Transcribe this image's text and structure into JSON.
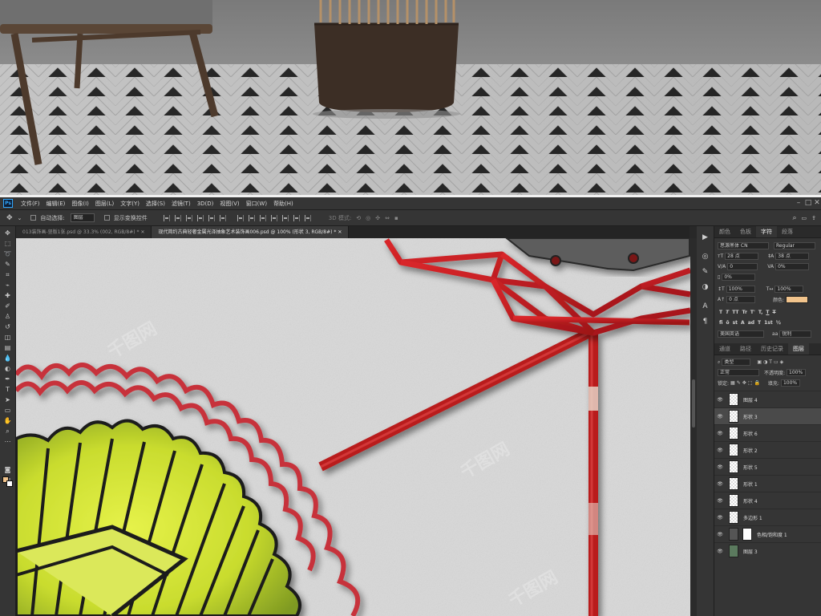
{
  "menu": {
    "ps_logo": "Ps",
    "items": [
      "文件(F)",
      "编辑(E)",
      "图像(I)",
      "图层(L)",
      "文字(Y)",
      "选择(S)",
      "滤镜(T)",
      "3D(D)",
      "视图(V)",
      "窗口(W)",
      "帮助(H)"
    ]
  },
  "options": {
    "auto_select_label": "自动选择:",
    "auto_select_value": "图层",
    "show_transform_label": "显示变换控件",
    "mode_3d_label": "3D 模式:"
  },
  "doc_tabs": [
    "013装饰画-竖版1张.psd @ 33.3% (002, RGB/8#) *",
    "现代简约古典轻奢金属光泽抽象艺术装饰画006.psd @ 100% (形状 3, RGB/8#) *"
  ],
  "character_panel": {
    "tabs": [
      "颜色",
      "色板",
      "字符",
      "段落"
    ],
    "font_family": "思源黑体 CN",
    "font_style": "Regular",
    "size": "28 点",
    "leading": "38 点",
    "kerning": "0",
    "tracking": "0%",
    "vertical_scale": "100%",
    "horizontal_scale": "100%",
    "baseline": "0 点",
    "color_label": "颜色:",
    "color": "#f2c48c",
    "style_buttons": [
      "T",
      "T",
      "TT",
      "Tr",
      "T'",
      "T,",
      "T",
      "T"
    ],
    "opentype_buttons": [
      "fi",
      "ō",
      "st",
      "A",
      "ad",
      "T",
      "1st",
      "½"
    ],
    "language": "美国英语",
    "antialias": "锐利"
  },
  "layers_panel": {
    "tabs": [
      "通道",
      "路径",
      "历史记录",
      "图层"
    ],
    "filter_label": "类型",
    "blend_mode": "正常",
    "opacity_label": "不透明度:",
    "opacity": "100%",
    "lock_label": "锁定:",
    "fill_label": "填充:",
    "fill": "100%",
    "layers": [
      "图层 4",
      "形状 3",
      "形状 6",
      "形状 2",
      "形状 5",
      "形状 1",
      "形状 4",
      "多边形 1",
      "色相/饱和度 1",
      "图层 3"
    ]
  }
}
